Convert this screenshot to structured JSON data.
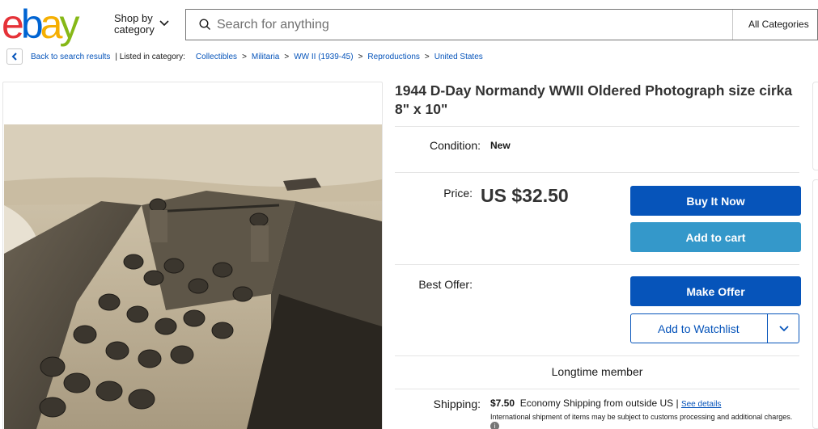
{
  "header": {
    "logo_letters": [
      "e",
      "b",
      "a",
      "y"
    ],
    "logo_colors": [
      "#e53238",
      "#0064d2",
      "#f5af02",
      "#86b817"
    ],
    "shop_by_line1": "Shop by",
    "shop_by_line2": "category",
    "search_placeholder": "Search for anything",
    "category_select": "All Categories"
  },
  "breadcrumb": {
    "back_label": "Back to search results",
    "listed_in_label": "| Listed in category:",
    "items": [
      "Collectibles",
      "Militaria",
      "WW II (1939-45)",
      "Reproductions",
      "United States"
    ],
    "separator": ">"
  },
  "listing": {
    "title": "1944 D-Day Normandy WWII Oldered Photograph size cirka 8\" x 10\"",
    "condition_label": "Condition:",
    "condition_value": "New",
    "price_label": "Price:",
    "price": "US $32.50",
    "best_offer_label": "Best Offer:",
    "buy_now": "Buy It Now",
    "add_to_cart": "Add to cart",
    "make_offer": "Make Offer",
    "add_to_watchlist": "Add to Watchlist",
    "member_status": "Longtime member",
    "shipping_label": "Shipping:",
    "shipping_cost": "$7.50",
    "shipping_method": "Economy Shipping from outside US |",
    "see_details": "See details",
    "shipping_note": "International shipment of items may be subject to customs processing and additional charges."
  },
  "colors": {
    "primary_blue": "#0654ba",
    "secondary_blue": "#3498ca"
  }
}
